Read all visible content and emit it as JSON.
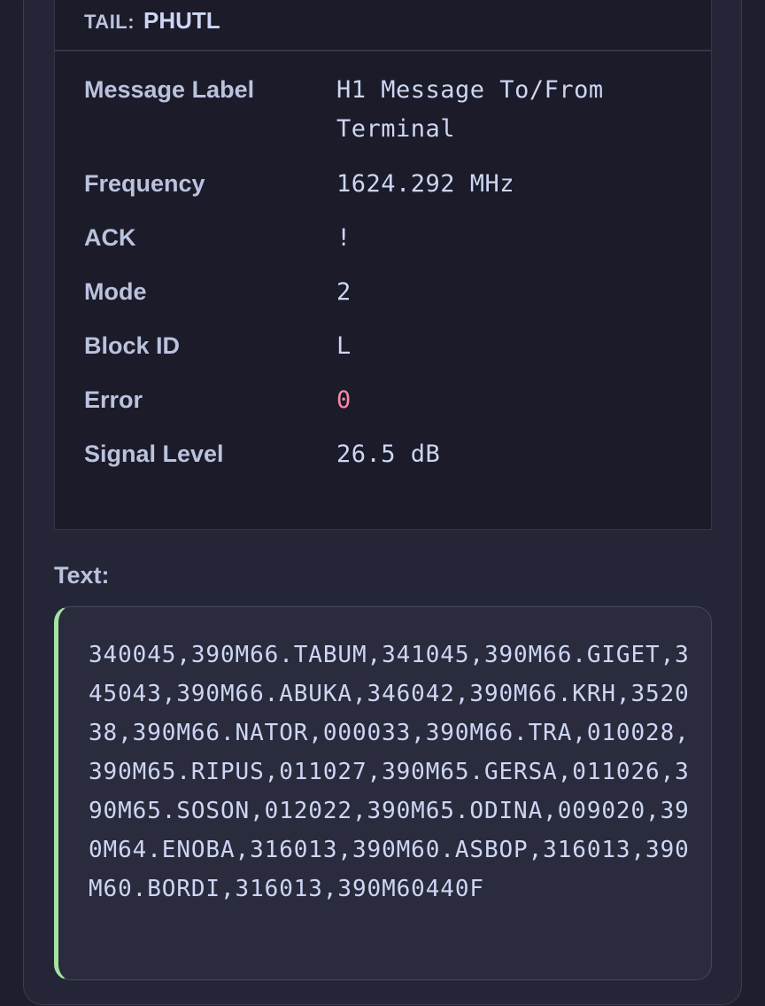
{
  "tail": {
    "label": "TAIL:",
    "value": "PHUTL"
  },
  "fields": {
    "message_label": {
      "name": "Message Label",
      "value": "H1 Message To/From Terminal"
    },
    "frequency": {
      "name": "Frequency",
      "value": "1624.292 MHz"
    },
    "ack": {
      "name": "ACK",
      "value": "!"
    },
    "mode": {
      "name": "Mode",
      "value": "2"
    },
    "block_id": {
      "name": "Block ID",
      "value": "L"
    },
    "error": {
      "name": "Error",
      "value": "0"
    },
    "signal_level": {
      "name": "Signal Level",
      "value": "26.5 dB"
    }
  },
  "text_section": {
    "heading": "Text:",
    "content": "340045,390M66.TABUM,341045,390M66.GIGET,345043,390M66.ABUKA,346042,390M66.KRH,352038,390M66.NATOR,000033,390M66.TRA,010028,390M65.RIPUS,011027,390M65.GERSA,011026,390M65.SOSON,012022,390M65.ODINA,009020,390M64.ENOBA,316013,390M60.ASBOP,316013,390M60.BORDI,316013,390M60440F"
  },
  "colors": {
    "error_value": "#f38ba8",
    "text_accent": "#a6e3a1"
  }
}
